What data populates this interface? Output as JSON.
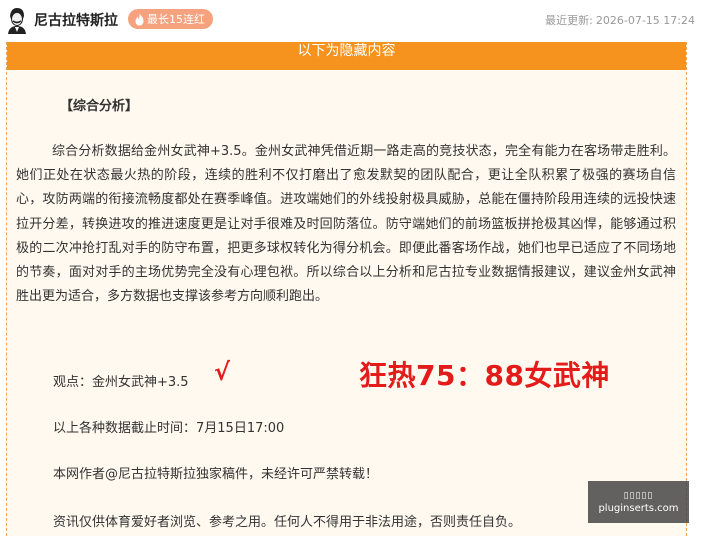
{
  "header": {
    "author": "尼古拉特斯拉",
    "badge": "最长15连红",
    "updated_label": "最近更新:",
    "updated_time": "2026-07-15 17:24"
  },
  "content": {
    "hidden_bar": "以下为隐藏内容",
    "section_title": "【综合分析】",
    "paragraph": "综合分析数据给金州女武神+3.5。金州女武神凭借近期一路走高的竞技状态，完全有能力在客场带走胜利。她们正处在状态最火热的阶段，连续的胜利不仅打磨出了愈发默契的团队配合，更让全队积累了极强的赛场自信心，攻防两端的衔接流畅度都处在赛季峰值。进攻端她们的外线投射极具威胁，总能在僵持阶段用连续的远投快速拉开分差，转换进攻的推进速度更是让对手很难及时回防落位。防守端她们的前场篮板拼抢极其凶悍，能够通过积极的二次冲抢打乱对手的防守布置，把更多球权转化为得分机会。即便此番客场作战，她们也早已适应了不同场地的节奏，面对对手的主场优势完全没有心理包袱。所以综合以上分析和尼古拉专业数据情报建议，建议金州女武神胜出更为适合，多方数据也支撑该参考方向顺利跑出。",
    "opinion": "观点：金州女武神+3.5",
    "check_mark": "√",
    "highlight": "狂热75：88女武神",
    "cutoff": "以上各种数据截止时间：7月15日17:00",
    "copyright": "本网作者@尼古拉特斯拉独家稿件，未经许可严禁转载！",
    "disclaimer": "资讯仅供体育爱好者浏览、参考之用。任何人不得用于非法用途，否则责任自负。"
  },
  "watermark": {
    "line1": "▯▯▯▯▯",
    "line2": "pluginserts.com"
  },
  "colors": {
    "accent_orange": "#f6931f",
    "badge_bg": "#f6a27f",
    "highlight_red": "#e41b1b",
    "panel_bg": "#fff9ef"
  }
}
